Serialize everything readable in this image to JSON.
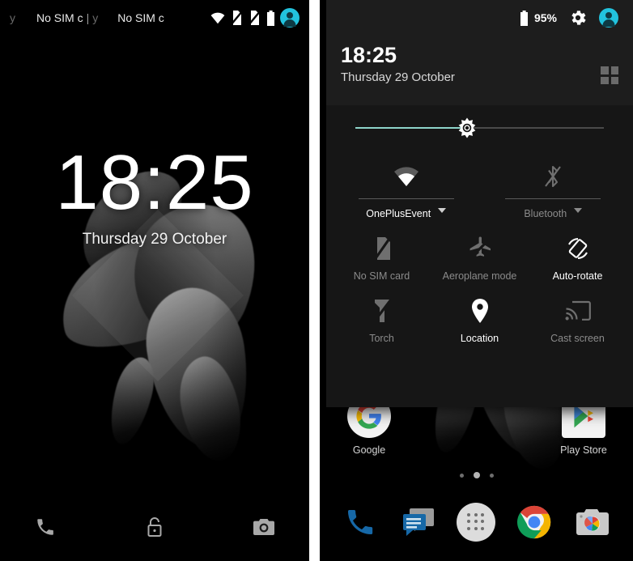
{
  "lock_screen": {
    "status_bar": {
      "carrier_left_prefix": "y",
      "carrier_left": "No SIM c",
      "separator": "|",
      "carrier_right_prefix": "y",
      "carrier_right": "No SIM c",
      "icons": [
        "wifi-icon",
        "no-sim-1-icon",
        "no-sim-2-icon",
        "battery-icon",
        "user-avatar-icon"
      ]
    },
    "clock": {
      "time": "18:25",
      "date": "Thursday 29 October"
    },
    "shortcuts": [
      {
        "name": "phone-shortcut",
        "icon": "phone-icon"
      },
      {
        "name": "unlock-indicator",
        "icon": "unlock-padlock-icon"
      },
      {
        "name": "camera-shortcut",
        "icon": "camera-icon"
      }
    ]
  },
  "quick_settings": {
    "status_bar": {
      "battery_percent": "95%",
      "settings_icon": "gear-icon",
      "avatar_icon": "user-avatar-icon"
    },
    "header": {
      "time": "18:25",
      "date": "Thursday 29 October",
      "edit_tiles_icon": "grid-2x2-icon"
    },
    "brightness": {
      "label": "brightness-slider",
      "value_percent": 45,
      "fill_color": "#8ED4CA",
      "track_color": "#4A4A4A",
      "thumb_icon": "brightness-sun-icon"
    },
    "tiles_row_detail": [
      {
        "label": "OnePlusEvent",
        "icon": "wifi-icon",
        "state": "on",
        "has_caret": true
      },
      {
        "label": "Bluetooth",
        "icon": "bluetooth-off-icon",
        "state": "off",
        "has_caret": true
      }
    ],
    "tiles": [
      [
        {
          "label": "No SIM card",
          "icon": "no-sim-card-icon",
          "state": "off"
        },
        {
          "label": "Aeroplane mode",
          "icon": "airplane-icon",
          "state": "off"
        },
        {
          "label": "Auto-rotate",
          "icon": "auto-rotate-icon",
          "state": "on"
        }
      ],
      [
        {
          "label": "Torch",
          "icon": "torch-off-icon",
          "state": "off"
        },
        {
          "label": "Location",
          "icon": "location-pin-icon",
          "state": "on"
        },
        {
          "label": "Cast screen",
          "icon": "cast-screen-icon",
          "state": "off"
        }
      ]
    ],
    "home_screen": {
      "apps": [
        {
          "label": "Google",
          "icon": "google-icon"
        },
        {
          "label": "Play Store",
          "icon": "play-store-icon"
        }
      ],
      "page_dots": {
        "count": 3,
        "active_index": 1
      },
      "dock": [
        {
          "name": "phone-app",
          "icon": "phone-icon"
        },
        {
          "name": "messages-app",
          "icon": "messages-icon"
        },
        {
          "name": "app-drawer",
          "icon": "app-drawer-icon"
        },
        {
          "name": "chrome-app",
          "icon": "chrome-icon"
        },
        {
          "name": "camera-app",
          "icon": "camera-icon"
        }
      ]
    }
  },
  "theme": {
    "accent_cyan": "#22C3DE",
    "slider_teal": "#8ED4CA",
    "panel_bg": "#161616",
    "header_bg": "#1D1D1D"
  }
}
